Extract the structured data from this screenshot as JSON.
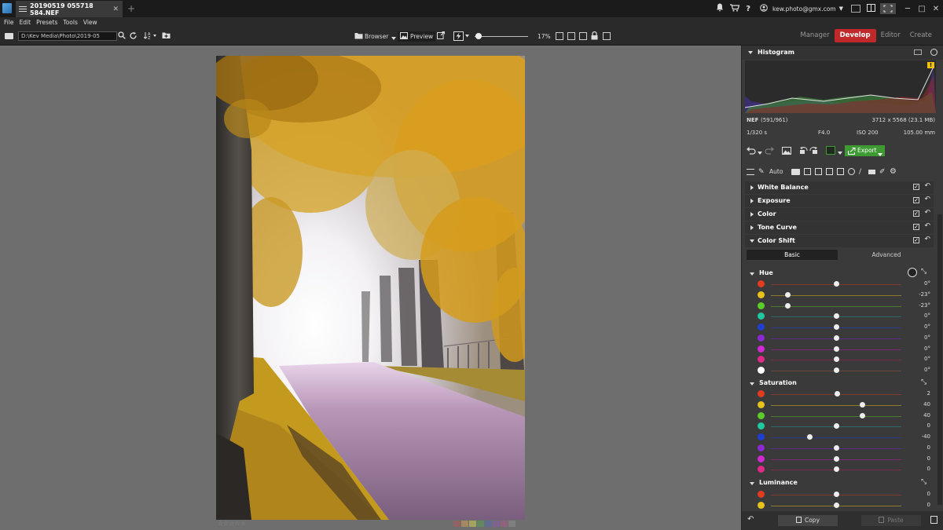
{
  "window": {
    "tab_title": "20190519 055718 584.NEF",
    "tab_close": "✕",
    "tab_add": "+",
    "user_email": "kew.photo@gmx.com"
  },
  "menu": [
    "File",
    "Edit",
    "Presets",
    "Tools",
    "View"
  ],
  "toolbar": {
    "path": "D:\\Kev Media\\Photo\\2019-05",
    "browser_label": "Browser",
    "preview_label": "Preview",
    "zoom": "17%",
    "zoom_level": 0.07
  },
  "modes": [
    {
      "label": "Manager",
      "active": false
    },
    {
      "label": "Develop",
      "active": true
    },
    {
      "label": "Editor",
      "active": false
    },
    {
      "label": "Create",
      "active": false
    }
  ],
  "histogram": {
    "title": "Histogram",
    "warning": "!"
  },
  "file_info": {
    "format": "NEF",
    "index": "(591/961)",
    "dimensions": "3712 x 5568 (23.1 MB)",
    "shutter": "1/320 s",
    "aperture": "F4.0",
    "iso": "ISO 200",
    "focal": "105.00 mm"
  },
  "actions": {
    "export_label": "Export",
    "auto_label": "Auto"
  },
  "sections": [
    {
      "label": "White Balance"
    },
    {
      "label": "Exposure"
    },
    {
      "label": "Color"
    },
    {
      "label": "Tone Curve"
    },
    {
      "label": "Color Shift"
    }
  ],
  "check_mark": "✓",
  "subtabs": {
    "basic": "Basic",
    "advanced": "Advanced"
  },
  "hue": {
    "label": "Hue",
    "rows": [
      {
        "color": "#e23b1f",
        "value": "0°",
        "pos": 0.5,
        "track": "#7a3a2c"
      },
      {
        "color": "#e6c21a",
        "value": "-23°",
        "pos": 0.13,
        "track": "#8a7a2a"
      },
      {
        "color": "#5ccc2a",
        "value": "-23°",
        "pos": 0.13,
        "track": "#4a7a2a"
      },
      {
        "color": "#1fc9a0",
        "value": "0°",
        "pos": 0.5,
        "track": "#2a6a6a"
      },
      {
        "color": "#1f3fd0",
        "value": "0°",
        "pos": 0.5,
        "track": "#2a3a8a"
      },
      {
        "color": "#8a2ad0",
        "value": "0°",
        "pos": 0.5,
        "track": "#5a2a8a"
      },
      {
        "color": "#d02ad0",
        "value": "0°",
        "pos": 0.5,
        "track": "#7a2a7a"
      },
      {
        "color": "#e02a8a",
        "value": "0°",
        "pos": 0.5,
        "track": "#7a2a4a"
      },
      {
        "color": "#ffffff",
        "value": "0°",
        "pos": 0.5,
        "track": "#6a4a3a"
      }
    ]
  },
  "saturation": {
    "label": "Saturation",
    "rows": [
      {
        "color": "#e23b1f",
        "value": "2",
        "pos": 0.51,
        "track": "#7a3a2c"
      },
      {
        "color": "#e6c21a",
        "value": "40",
        "pos": 0.7,
        "track": "#8a7a2a"
      },
      {
        "color": "#5ccc2a",
        "value": "40",
        "pos": 0.7,
        "track": "#4a7a2a"
      },
      {
        "color": "#1fc9a0",
        "value": "0",
        "pos": 0.5,
        "track": "#2a6a6a"
      },
      {
        "color": "#1f3fd0",
        "value": "-40",
        "pos": 0.3,
        "track": "#2a3a8a"
      },
      {
        "color": "#8a2ad0",
        "value": "0",
        "pos": 0.5,
        "track": "#5a2a8a"
      },
      {
        "color": "#d02ad0",
        "value": "0",
        "pos": 0.5,
        "track": "#7a2a7a"
      },
      {
        "color": "#e02a8a",
        "value": "0",
        "pos": 0.5,
        "track": "#7a2a4a"
      }
    ]
  },
  "luminance": {
    "label": "Luminance",
    "rows": [
      {
        "color": "#e23b1f",
        "value": "0",
        "pos": 0.5,
        "track": "#7a3a2c"
      },
      {
        "color": "#e6c21a",
        "value": "0",
        "pos": 0.5,
        "track": "#8a7a2a"
      }
    ]
  },
  "bottom": {
    "copy_label": "Copy",
    "paste_label": "Paste"
  },
  "color_labels": [
    "#a85a5a",
    "#c89a5a",
    "#c8c85a",
    "#5a9a5a",
    "#5a6aa8",
    "#8a5aa8",
    "#a85a8a",
    "#8a8a8a"
  ],
  "rating_stars": "☆☆☆☆☆"
}
